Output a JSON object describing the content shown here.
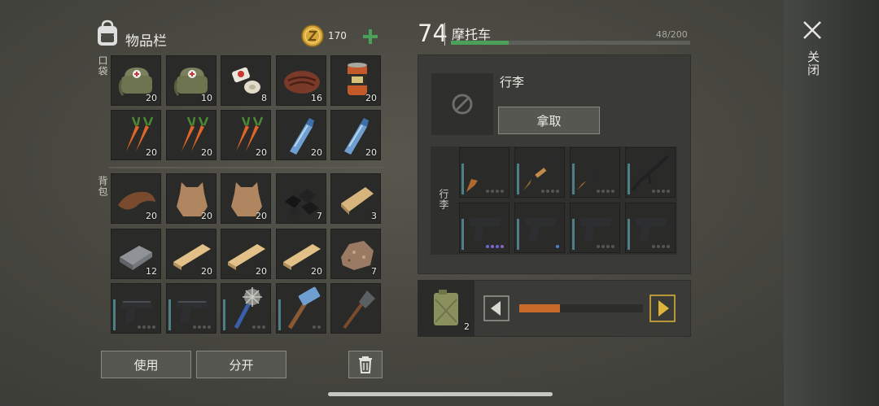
{
  "inventory": {
    "title": "物品栏",
    "coins": "170",
    "pockets_label": "口袋",
    "backpack_label": "背包",
    "pockets": [
      {
        "name": "medkit-bag",
        "count": "20"
      },
      {
        "name": "medkit-bag",
        "count": "10"
      },
      {
        "name": "bandage",
        "count": "8"
      },
      {
        "name": "steak",
        "count": "16"
      },
      {
        "name": "canned-food",
        "count": "20"
      },
      {
        "name": "carrot",
        "count": "20"
      },
      {
        "name": "carrot",
        "count": "20"
      },
      {
        "name": "carrot",
        "count": "20"
      },
      {
        "name": "water-bottle",
        "count": "20"
      },
      {
        "name": "water-bottle",
        "count": "20"
      }
    ],
    "backpack": [
      {
        "name": "leather",
        "count": "20"
      },
      {
        "name": "animal-hide",
        "count": "20"
      },
      {
        "name": "animal-hide",
        "count": "20"
      },
      {
        "name": "coal",
        "count": "7"
      },
      {
        "name": "wood-plank",
        "count": "3"
      },
      {
        "name": "iron-ingot",
        "count": "12"
      },
      {
        "name": "wood-board",
        "count": "20"
      },
      {
        "name": "wood-board",
        "count": "20"
      },
      {
        "name": "wood-board",
        "count": "20"
      },
      {
        "name": "stone",
        "count": "7"
      },
      {
        "name": "pistol",
        "count": ""
      },
      {
        "name": "pistol",
        "count": ""
      },
      {
        "name": "spiked-mace",
        "count": ""
      },
      {
        "name": "sledgehammer",
        "count": ""
      },
      {
        "name": "shovel",
        "count": ""
      }
    ],
    "use_button": "使用",
    "split_button": "分开"
  },
  "vehicle": {
    "level": "74",
    "name": "摩托车",
    "capacity": "48/200",
    "capacity_fraction": 0.24,
    "luggage_title": "行李",
    "take_button": "拿取",
    "grid_label": "行李",
    "weapons": [
      "rifle",
      "shotgun",
      "assault-rifle",
      "assault-rifle",
      "pistol",
      "pistol",
      "pistol",
      "pistol"
    ],
    "fuel_count": "2",
    "fuel_fill": 0.33
  },
  "close_label": "关闭",
  "colors": {
    "accent": "#4ba05a",
    "coin": "#d6a63a",
    "fuel": "#c9692a",
    "arrow": "#e0b43a",
    "slotBar": "#4d7f86"
  }
}
